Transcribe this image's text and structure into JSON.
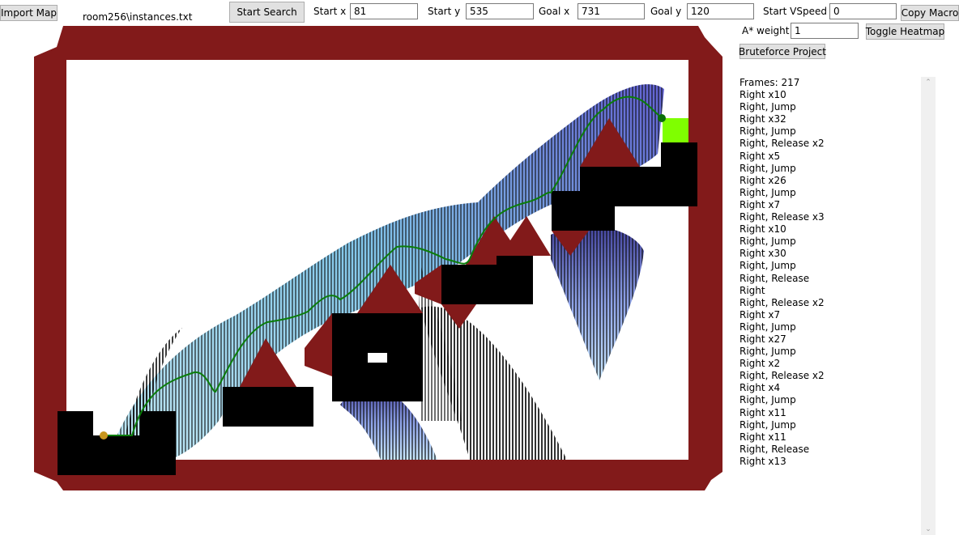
{
  "toolbar": {
    "import_label": "Import Map",
    "file_name": "room256\\instances.txt",
    "start_search_label": "Start Search",
    "start_x_label": "Start x",
    "start_x_value": "81",
    "start_y_label": "Start y",
    "start_y_value": "535",
    "goal_x_label": "Goal x",
    "goal_x_value": "731",
    "goal_y_label": "Goal y",
    "goal_y_value": "120",
    "start_vspeed_label": "Start VSpeed",
    "start_vspeed_value": "0",
    "copy_macro_label": "Copy Macro",
    "astar_weight_label": "A* weight",
    "astar_weight_value": "1",
    "toggle_heatmap_label": "Toggle Heatmap",
    "bruteforce_label": "Bruteforce Project"
  },
  "colors": {
    "wall": "#821a1a",
    "block": "#000000",
    "path": "#0a7d0a",
    "goal": "#7fff00",
    "start_marker": "#c8961e",
    "end_marker": "#0a6e0a"
  },
  "output": {
    "frames": "Frames: 217",
    "lines": [
      "Right x10",
      "Right, Jump",
      "Right x32",
      "Right, Jump",
      "Right, Release x2",
      "Right x5",
      "Right, Jump",
      "Right x26",
      "Right, Jump",
      "Right x7",
      "Right, Release x3",
      "Right x10",
      "Right, Jump",
      "Right x30",
      "Right, Jump",
      "Right, Release",
      "Right",
      "Right, Release x2",
      "Right x7",
      "Right, Jump",
      "Right x27",
      "Right, Jump",
      "Right x2",
      "Right, Release x2",
      "Right x4",
      "Right, Jump",
      "Right x11",
      "Right, Jump",
      "Right x11",
      "Right, Release",
      "Right x13"
    ]
  }
}
